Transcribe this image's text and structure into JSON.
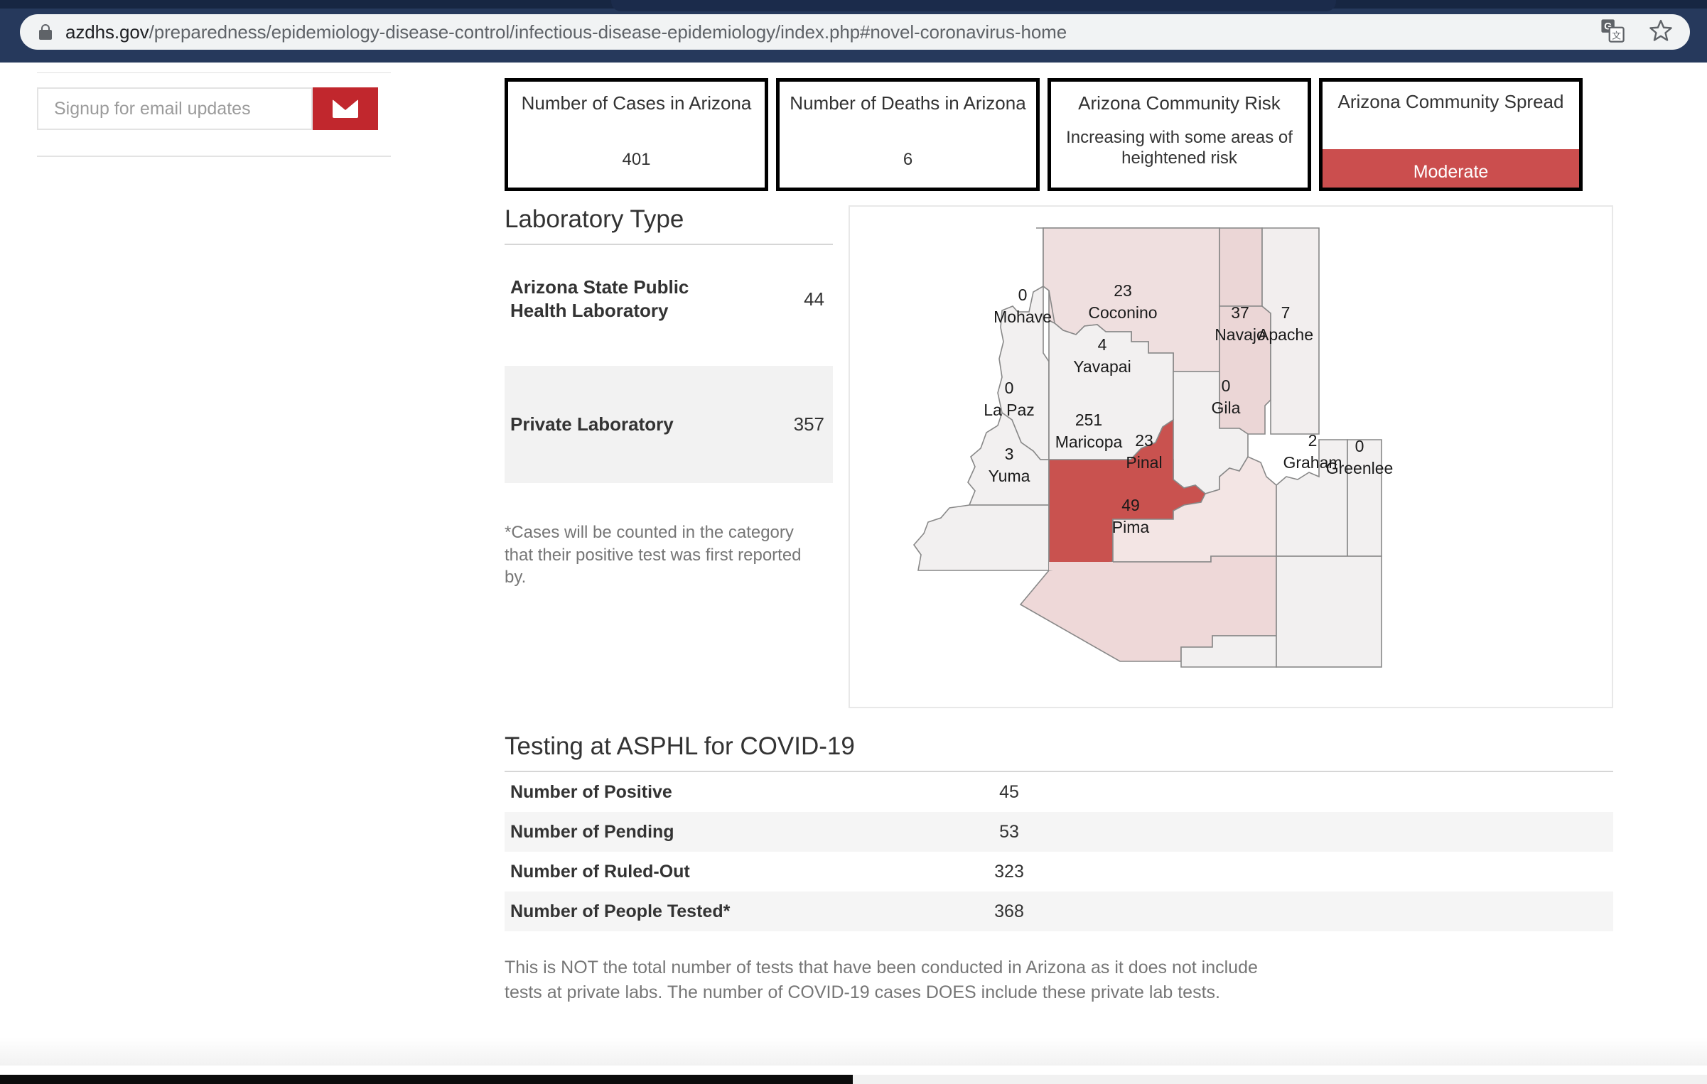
{
  "browser": {
    "url_domain": "azdhs.gov",
    "url_path": "/preparedness/epidemiology-disease-control/infectious-disease-epidemiology/index.php#novel-coronavirus-home",
    "lock_icon": "lock-icon",
    "translate_icon": "google-translate-icon",
    "bookmark_icon": "star-bookmark-icon"
  },
  "sidebar": {
    "signup_placeholder": "Signup for email updates",
    "signup_value": "",
    "submit_icon": "envelope-icon"
  },
  "stat_cards": [
    {
      "title": "Number of Cases in Arizona",
      "value": "401"
    },
    {
      "title": "Number of Deaths in Arizona",
      "value": "6"
    },
    {
      "title": "Arizona Community Risk",
      "subtitle": "Increasing with some areas of heightened risk"
    },
    {
      "title": "Arizona Community Spread",
      "band_label": "Moderate",
      "band_color": "#cb4e4e"
    }
  ],
  "laboratory": {
    "heading": "Laboratory Type",
    "rows": [
      {
        "name": "Arizona State Public Health Laboratory",
        "count": "44"
      },
      {
        "name": "Private Laboratory",
        "count": "357"
      }
    ],
    "footnote": "*Cases will be counted in the category that their positive test was first reported by."
  },
  "map": {
    "counties": [
      {
        "name": "Mohave",
        "value": "0",
        "fill": "#f2f0f0"
      },
      {
        "name": "Coconino",
        "value": "23",
        "fill": "#efdfdf"
      },
      {
        "name": "Navajo",
        "value": "37",
        "fill": "#ebd6d6"
      },
      {
        "name": "Apache",
        "value": "7",
        "fill": "#f2eeee"
      },
      {
        "name": "Yavapai",
        "value": "4",
        "fill": "#f2f0f0"
      },
      {
        "name": "La Paz",
        "value": "0",
        "fill": "#f2f0f0"
      },
      {
        "name": "Maricopa",
        "value": "251",
        "fill": "#c9524f"
      },
      {
        "name": "Gila",
        "value": "0",
        "fill": "#f2f0f0"
      },
      {
        "name": "Graham",
        "value": "2",
        "fill": "#f2f0f0"
      },
      {
        "name": "Greenlee",
        "value": "0",
        "fill": "#f2f0f0"
      },
      {
        "name": "Yuma",
        "value": "3",
        "fill": "#f2f0f0"
      },
      {
        "name": "Pinal",
        "value": "23",
        "fill": "#f3e5e4"
      },
      {
        "name": "Pima",
        "value": "49",
        "fill": "#eed8d8"
      }
    ]
  },
  "testing": {
    "heading": "Testing at ASPHL for COVID-19",
    "rows": [
      {
        "label": "Number of Positive",
        "value": "45"
      },
      {
        "label": "Number of Pending",
        "value": "53"
      },
      {
        "label": "Number of Ruled-Out",
        "value": "323"
      },
      {
        "label": "Number of People Tested*",
        "value": "368"
      }
    ],
    "footnote": "This is NOT the total number of tests that have been conducted in Arizona as it does not include tests at private labs. The number of COVID-19 cases DOES include these private lab tests."
  }
}
